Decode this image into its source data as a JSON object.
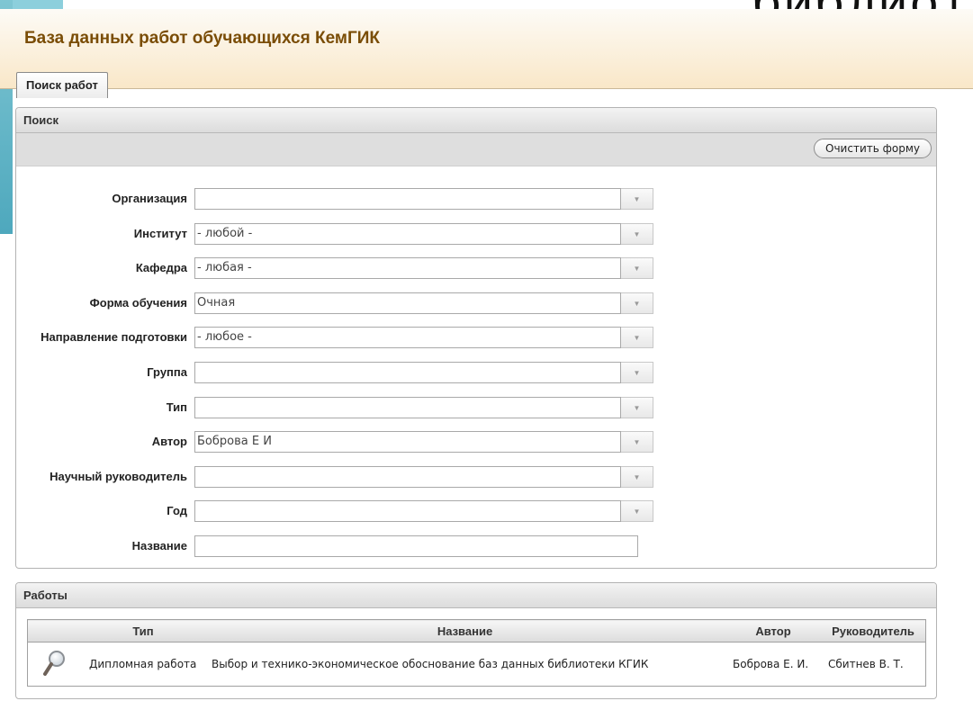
{
  "slide_fragment": "библиот",
  "app": {
    "title": "База данных работ обучающихся КемГИК",
    "tab": "Поиск работ"
  },
  "search": {
    "panel_title": "Поиск",
    "clear_button": "Очистить форму",
    "fields": [
      {
        "label": "Организация",
        "value": "",
        "type": "combo"
      },
      {
        "label": "Институт",
        "value": "- любой -",
        "type": "combo"
      },
      {
        "label": "Кафедра",
        "value": "- любая -",
        "type": "combo"
      },
      {
        "label": "Форма обучения",
        "value": "Очная",
        "type": "combo"
      },
      {
        "label": "Направление подготовки",
        "value": "- любое -",
        "type": "combo"
      },
      {
        "label": "Группа",
        "value": "",
        "type": "combo"
      },
      {
        "label": "Тип",
        "value": "",
        "type": "combo"
      },
      {
        "label": "Автор",
        "value": "Боброва Е И",
        "type": "combo"
      },
      {
        "label": "Научный руководитель",
        "value": "",
        "type": "combo"
      },
      {
        "label": "Год",
        "value": "",
        "type": "combo"
      },
      {
        "label": "Название",
        "value": "",
        "type": "text"
      }
    ]
  },
  "works": {
    "panel_title": "Работы",
    "columns": [
      "",
      "Тип",
      "Название",
      "Автор",
      "Руководитель"
    ],
    "rows": [
      {
        "icon": "magnifier-icon",
        "type": "Дипломная работа",
        "title": "Выбор и технико-экономическое обоснование баз данных библиотеки КГИК",
        "author": "Боброва Е. И.",
        "supervisor": "Сбитнев В. Т."
      }
    ]
  }
}
